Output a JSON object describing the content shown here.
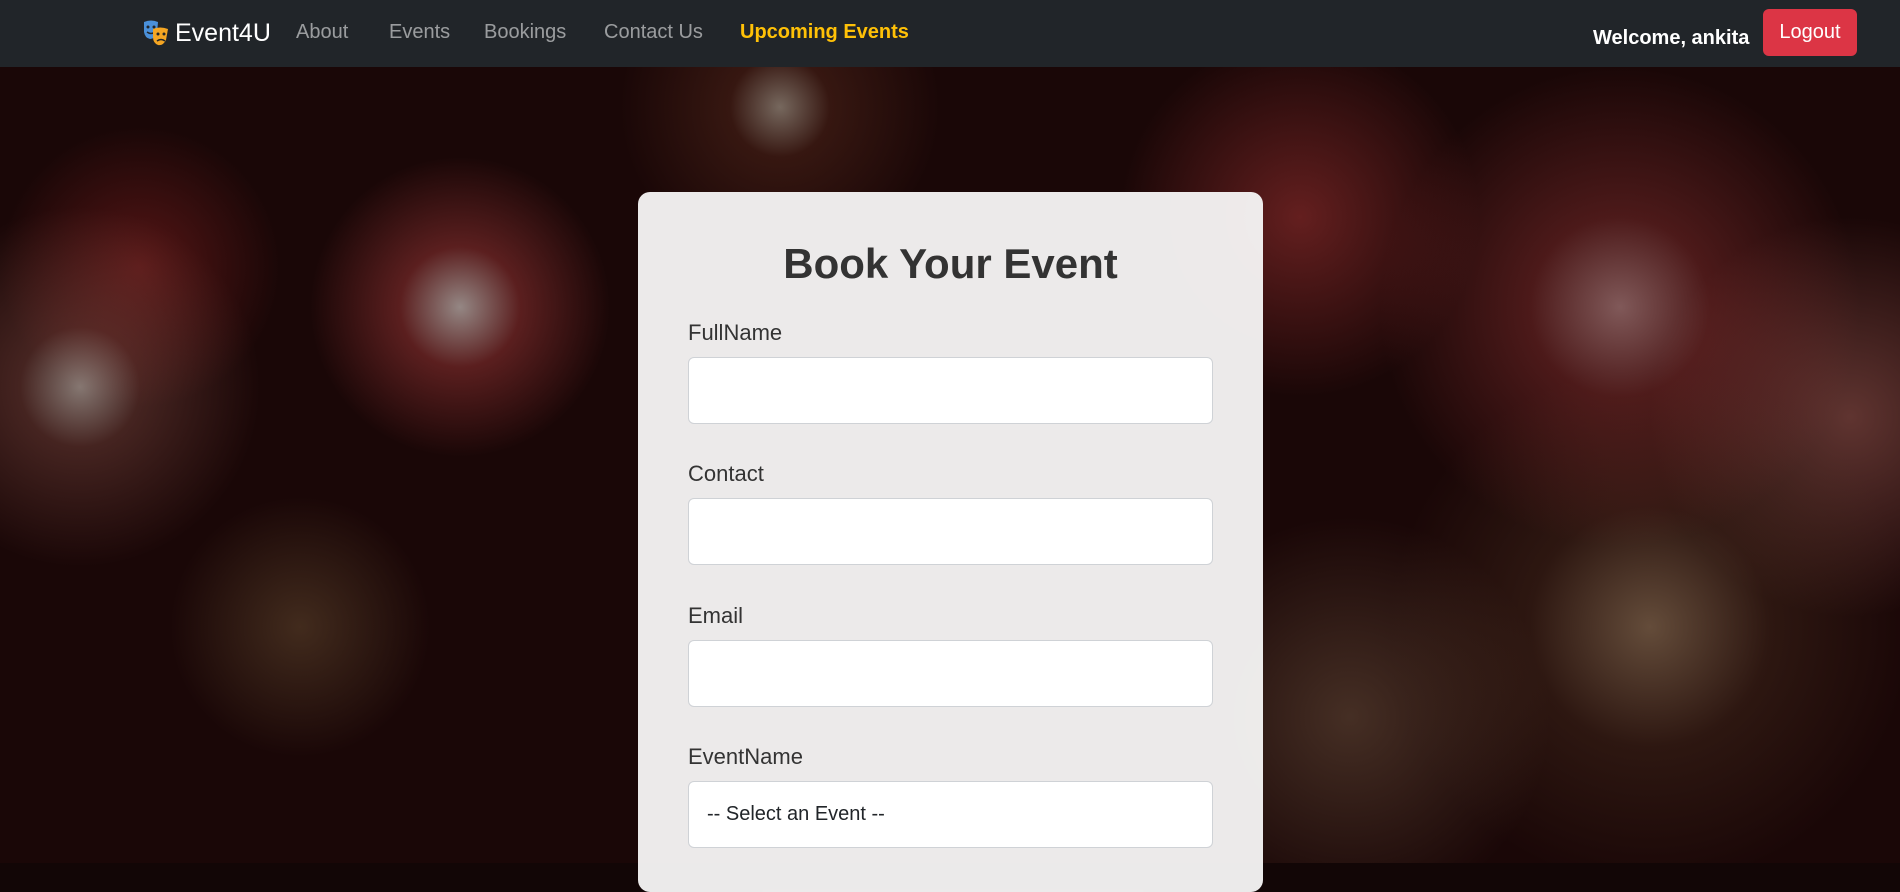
{
  "navbar": {
    "brand": "Event4U",
    "links": [
      "About",
      "Events",
      "Bookings",
      "Contact Us"
    ],
    "active_link": "Upcoming Events",
    "welcome": "Welcome, ankita",
    "logout": "Logout"
  },
  "form": {
    "title": "Book Your Event",
    "fields": [
      {
        "label": "FullName",
        "value": ""
      },
      {
        "label": "Contact",
        "value": ""
      },
      {
        "label": "Email",
        "value": ""
      },
      {
        "label": "EventName",
        "value": "-- Select an Event --"
      }
    ]
  },
  "colors": {
    "navbar_bg": "#212529",
    "active_link": "#ffc107",
    "logout_bg": "#dc3545"
  }
}
